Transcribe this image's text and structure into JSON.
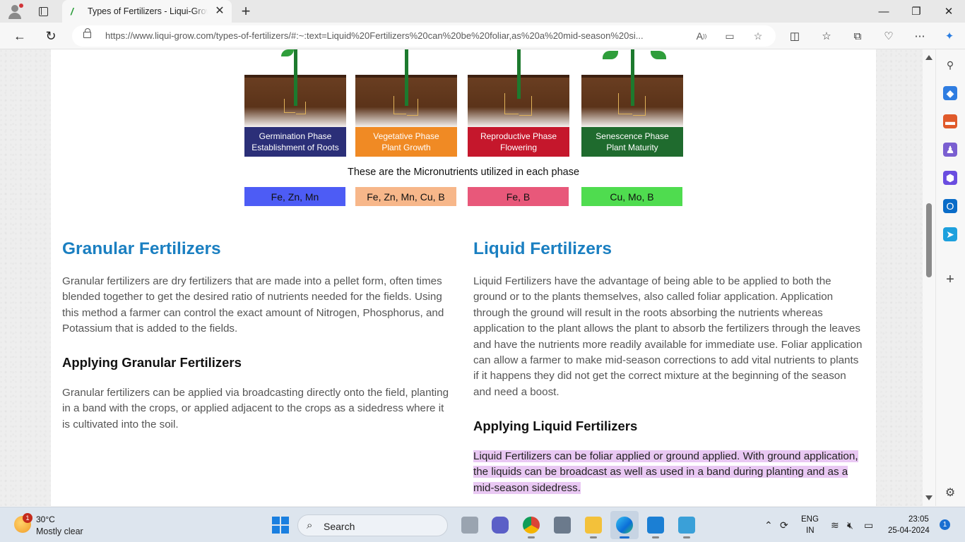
{
  "browser": {
    "tab_title": "Types of Fertilizers - Liqui-Grow",
    "url": "https://www.liqui-grow.com/types-of-fertilizers/#:~:text=Liquid%20Fertilizers%20can%20be%20foliar,as%20a%20mid-season%20si...",
    "window_controls": {
      "minimize": "—",
      "restore": "❐",
      "close": "✕"
    }
  },
  "infographic": {
    "phases": [
      {
        "label_line1": "Germination Phase",
        "label_line2": "Establishment of Roots",
        "color": "#2b2f78"
      },
      {
        "label_line1": "Vegetative Phase",
        "label_line2": "Plant Growth",
        "color": "#f08a24"
      },
      {
        "label_line1": "Reproductive Phase",
        "label_line2": "Flowering",
        "color": "#c5172c"
      },
      {
        "label_line1": "Senescence Phase",
        "label_line2": "Plant Maturity",
        "color": "#1f6b2e"
      }
    ],
    "caption": "These are the Micronutrients utilized in each phase",
    "micronutrients": [
      {
        "text": "Fe, Zn, Mn",
        "color": "#4d5cf5"
      },
      {
        "text": "Fe, Zn, Mn, Cu, B",
        "color": "#f7b78a"
      },
      {
        "text": "Fe, B",
        "color": "#e8587a"
      },
      {
        "text": "Cu, Mo, B",
        "color": "#4fdc4f"
      }
    ]
  },
  "granular": {
    "heading": "Granular Fertilizers",
    "paragraph": "Granular fertilizers are dry fertilizers that are made into a pellet form, often times blended together to get the desired ratio of nutrients needed for the fields. Using this method a farmer can control the exact amount of Nitrogen, Phosphorus, and Potassium that is added to the fields.",
    "sub_heading": "Applying Granular Fertilizers",
    "sub_paragraph": "Granular fertilizers can be applied via broadcasting directly onto the field, planting in a band with the crops, or applied adjacent to the crops as a sidedress where it is cultivated into the soil."
  },
  "liquid": {
    "heading": "Liquid Fertilizers",
    "paragraph": "Liquid Fertilizers have the advantage of being able to be applied to both the ground or to the plants themselves, also called foliar application. Application through the ground will result in the roots absorbing the nutrients whereas application to the plant allows the plant to absorb the fertilizers through the leaves and have the nutrients more readily available for immediate use.  Foliar application can allow a farmer to make mid-season corrections to add vital nutrients to plants if it happens they did not get the correct mixture at the beginning of the season and need a boost.",
    "sub_heading": "Applying Liquid Fertilizers",
    "sub_paragraph": "Liquid Fertilizers can be foliar applied or ground applied.  With ground application, the liquids can be broadcast as well as used in a band during planting and as a mid-season sidedress."
  },
  "taskbar": {
    "weather_badge": "1",
    "temperature": "30°C",
    "weather_desc": "Mostly clear",
    "search_label": "Search",
    "lang_line1": "ENG",
    "lang_line2": "IN",
    "time": "23:05",
    "date": "25-04-2024",
    "notifications": "1"
  }
}
